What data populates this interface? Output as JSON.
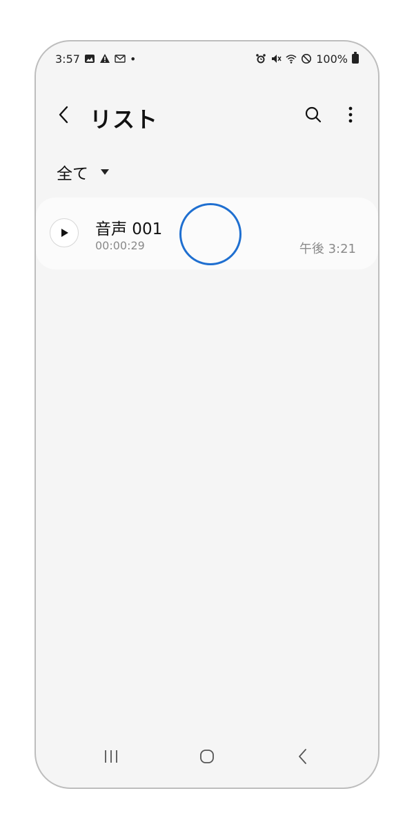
{
  "status_bar": {
    "time": "3:57",
    "dot": "•",
    "battery_text": "100%",
    "left_icons": [
      "image-icon",
      "warning-icon",
      "gmail-icon"
    ],
    "right_icons": [
      "alarm-icon",
      "mute-icon",
      "wifi-icon",
      "do-not-disturb-icon",
      "battery-icon"
    ]
  },
  "appbar": {
    "title": "リスト"
  },
  "filter": {
    "selected": "全て"
  },
  "recordings": [
    {
      "name": "音声 001",
      "duration": "00:00:29",
      "time": "午後 3:21"
    }
  ],
  "colors": {
    "background": "#f5f5f5",
    "card": "#fbfbfb",
    "touch_indicator": "#1f6fd0",
    "secondary_text": "#8a8a8a"
  }
}
